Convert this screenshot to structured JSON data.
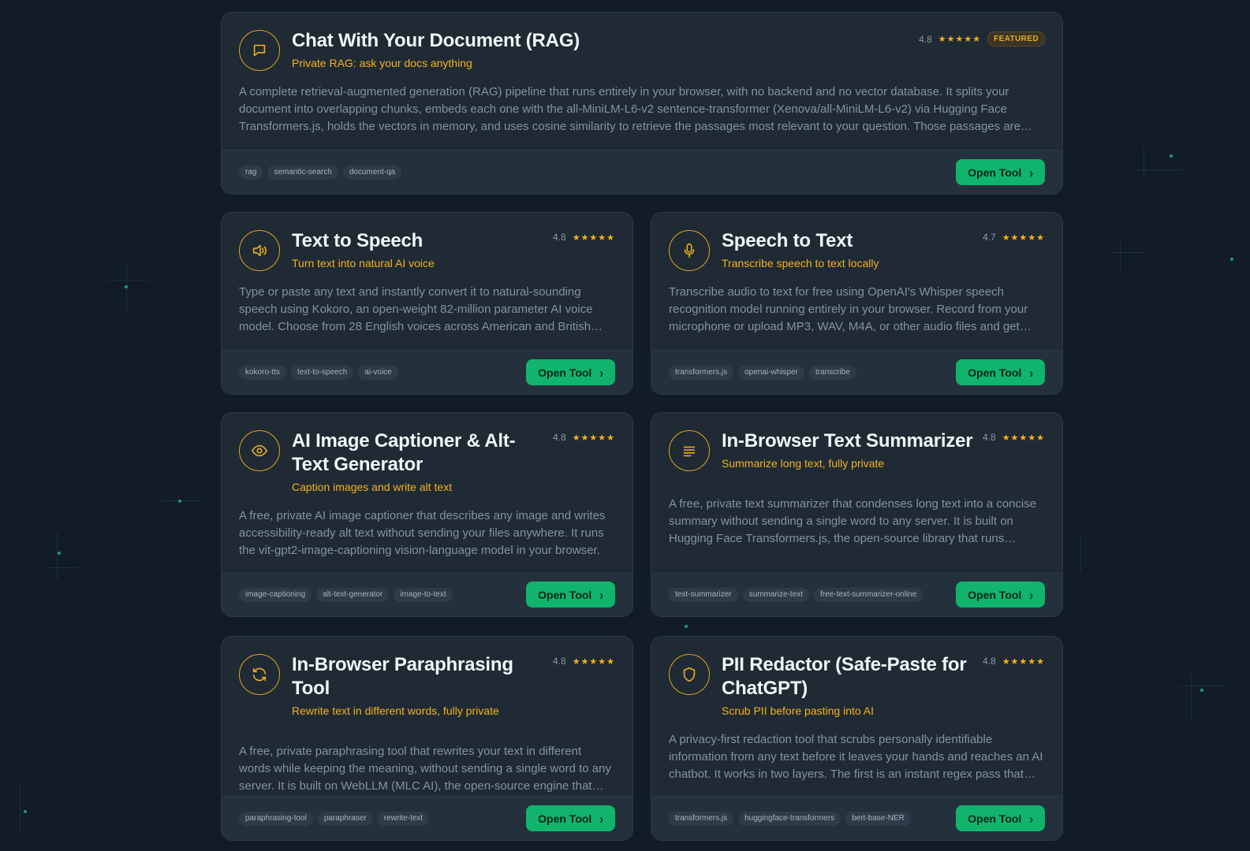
{
  "colors": {
    "background": "#111c26",
    "card": "#1f2a35",
    "accent": "#f5b21b",
    "button": "#10b46d"
  },
  "cards": [
    {
      "icon": "chat-bubble-icon",
      "title": "Chat With Your Document (RAG)",
      "tagline": "Private RAG: ask your docs anything",
      "rating": "4.8",
      "stars": "★★★★★",
      "badge": "FEATURED",
      "description": "A complete retrieval-augmented generation (RAG) pipeline that runs entirely in your browser, with no backend and no vector database. It splits your document into overlapping chunks, embeds each one with the all-MiniLM-L6-v2 sentence-transformer (Xenova/all-MiniLM-L6-v2) via Hugging Face Transformers.js, holds the vectors in memory, and uses cosine similarity to retrieve the passages most relevant to your question. Those passages are then passed to a language model.",
      "tags": [
        "rag",
        "semantic-search",
        "document-qa"
      ],
      "button": "Open Tool"
    },
    {
      "icon": "speaker-icon",
      "title": "Text to Speech",
      "tagline": "Turn text into natural AI voice",
      "rating": "4.8",
      "stars": "★★★★★",
      "description": "Type or paste any text and instantly convert it to natural-sounding speech using Kokoro, an open-weight 82-million parameter AI voice model. Choose from 28 English voices across American and British accents.",
      "tags": [
        "kokoro-tts",
        "text-to-speech",
        "ai-voice"
      ],
      "button": "Open Tool"
    },
    {
      "icon": "microphone-icon",
      "title": "Speech to Text",
      "tagline": "Transcribe speech to text locally",
      "rating": "4.7",
      "stars": "★★★★★",
      "description": "Transcribe audio to text for free using OpenAI's Whisper speech recognition model running entirely in your browser. Record from your microphone or upload MP3, WAV, M4A, or other audio files and get accurate transcripts.",
      "tags": [
        "transformers.js",
        "openai-whisper",
        "transcribe"
      ],
      "button": "Open Tool"
    },
    {
      "icon": "eye-icon",
      "title": "AI Image Captioner & Alt-Text Generator",
      "tagline": "Caption images and write alt text",
      "rating": "4.8",
      "stars": "★★★★★",
      "description": "A free, private AI image captioner that describes any image and writes accessibility-ready alt text without sending your files anywhere. It runs the vit-gpt2-image-captioning vision-language model in your browser.",
      "tags": [
        "image-captioning",
        "alt-text-generator",
        "image-to-text"
      ],
      "button": "Open Tool"
    },
    {
      "icon": "text-lines-icon",
      "title": "In-Browser Text Summarizer",
      "tagline": "Summarize long text, fully private",
      "rating": "4.8",
      "stars": "★★★★★",
      "description": "A free, private text summarizer that condenses long text into a concise summary without sending a single word to any server. It is built on Hugging Face Transformers.js, the open-source library that runs models locally.",
      "tags": [
        "text-summarizer",
        "summarize-text",
        "free-text-summarizer-online"
      ],
      "button": "Open Tool"
    },
    {
      "icon": "refresh-icon",
      "title": "In-Browser Paraphrasing Tool",
      "tagline": "Rewrite text in different words, fully private",
      "rating": "4.8",
      "stars": "★★★★★",
      "description": "A free, private paraphrasing tool that rewrites your text in different words while keeping the meaning, without sending a single word to any server. It is built on WebLLM (MLC AI), the open-source engine that runs models in your browser.",
      "tags": [
        "paraphrasing-tool",
        "paraphraser",
        "rewrite-text"
      ],
      "button": "Open Tool"
    },
    {
      "icon": "shield-icon",
      "title": "PII Redactor (Safe-Paste for ChatGPT)",
      "tagline": "Scrub PII before pasting into AI",
      "rating": "4.8",
      "stars": "★★★★★",
      "description": "A privacy-first redaction tool that scrubs personally identifiable information from any text before it leaves your hands and reaches an AI chatbot. It works in two layers. The first is an instant regex pass that catches common patterns.",
      "tags": [
        "transformers.js",
        "huggingface-transformers",
        "bert-base-NER"
      ],
      "button": "Open Tool"
    }
  ]
}
